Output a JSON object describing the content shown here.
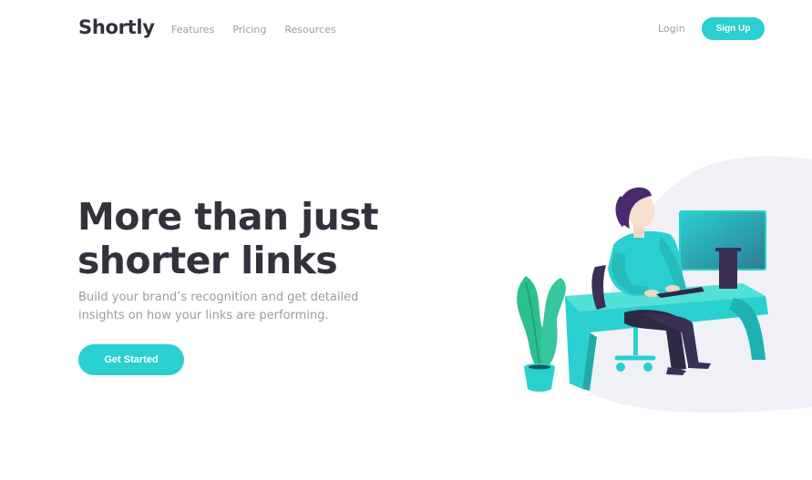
{
  "header": {
    "logo": "Shortly",
    "nav": [
      {
        "label": "Features"
      },
      {
        "label": "Pricing"
      },
      {
        "label": "Resources"
      }
    ],
    "login_label": "Login",
    "signup_label": "Sign Up"
  },
  "hero": {
    "headline_line1": "More than just",
    "headline_line2": "shorter links",
    "subtext": "Build your brand’s recognition and get detailed insights on how your links are performing.",
    "cta_label": "Get Started"
  },
  "colors": {
    "accent": "#2acfcf",
    "heading": "#34313d",
    "muted": "#9e9aa7",
    "illustration_bg": "#eff1f7"
  },
  "illustration": {
    "icon": "person-working-at-desk-illustration"
  }
}
